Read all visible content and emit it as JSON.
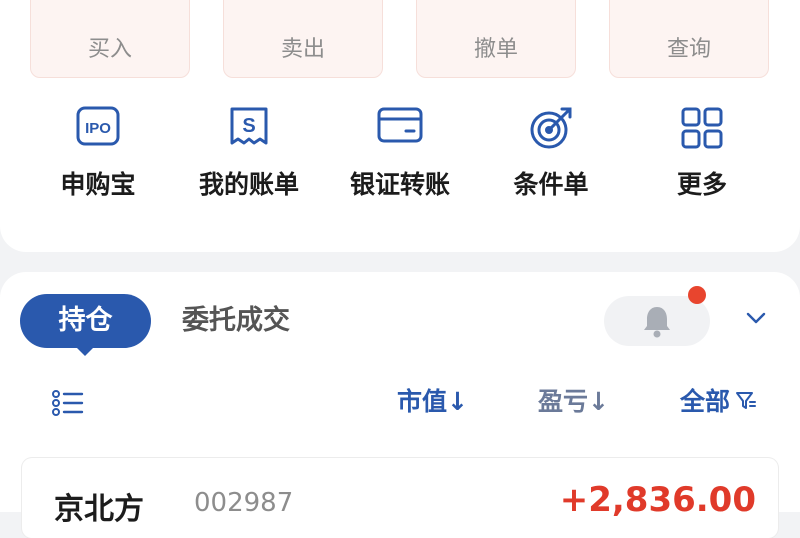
{
  "trade_buttons": [
    {
      "char": "买",
      "label": "买入",
      "color": "#d8382c"
    },
    {
      "char": "卖",
      "label": "卖出",
      "color": "#28925a"
    },
    {
      "char": "撤",
      "label": "撤单",
      "color": "#c85530"
    },
    {
      "char": "查",
      "label": "查询",
      "color": "#c85530"
    }
  ],
  "shortcuts": [
    {
      "icon": "ipo-icon",
      "icon_text": "IPO",
      "label": "申购宝"
    },
    {
      "icon": "bill-icon",
      "icon_text": "S",
      "label": "我的账单"
    },
    {
      "icon": "card-transfer-icon",
      "label": "银证转账"
    },
    {
      "icon": "target-icon",
      "label": "条件单"
    },
    {
      "icon": "grid-icon",
      "label": "更多"
    }
  ],
  "positions_panel": {
    "tab_active": "持仓",
    "tab_inactive": "委托成交",
    "sort_market_value": "市值↓",
    "sort_profit_loss": "盈亏↓",
    "filter_all": "全部"
  },
  "holdings": [
    {
      "name": "京北方",
      "code": "002987",
      "profit_loss": "+2,836.00"
    }
  ],
  "colors": {
    "accent": "#2a59ad",
    "up": "#e03a2a",
    "notify": "#e8452e"
  }
}
